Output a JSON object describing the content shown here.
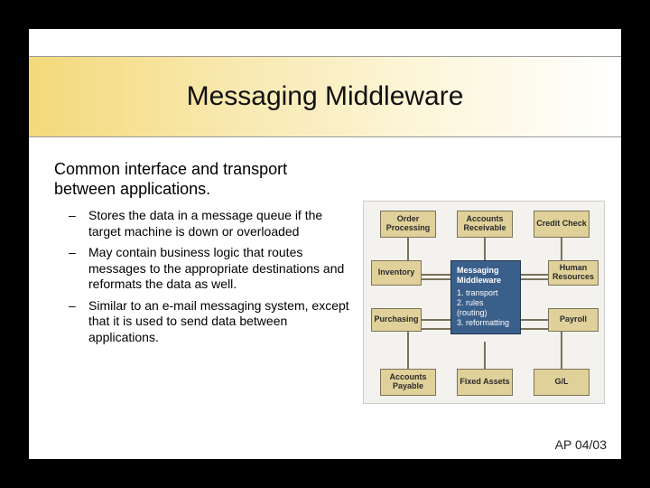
{
  "title": "Messaging Middleware",
  "intro": "Common interface and transport between applications.",
  "bullets": [
    "Stores the data in a message queue if the target machine is down or overloaded",
    "May contain business logic that routes messages to the appropriate destinations and reformats the data as well.",
    "Similar to an e-mail messaging system, except that it is used to send data between applications."
  ],
  "diagram": {
    "top": [
      {
        "label": "Order Processing"
      },
      {
        "label": "Accounts Receivable"
      },
      {
        "label": "Credit Check"
      }
    ],
    "leftMid": {
      "label": "Inventory"
    },
    "rightMid": {
      "label": "Human Resources"
    },
    "leftLow": {
      "label": "Purchasing"
    },
    "rightLow": {
      "label": "Payroll"
    },
    "bottom": [
      {
        "label": "Accounts Payable"
      },
      {
        "label": "Fixed Assets"
      },
      {
        "label": "G/L"
      }
    ],
    "center": {
      "heading": "Messaging Middleware",
      "lines": [
        "1. transport",
        "2. rules (routing)",
        "3. reformatting"
      ]
    }
  },
  "footer": "AP 04/03"
}
